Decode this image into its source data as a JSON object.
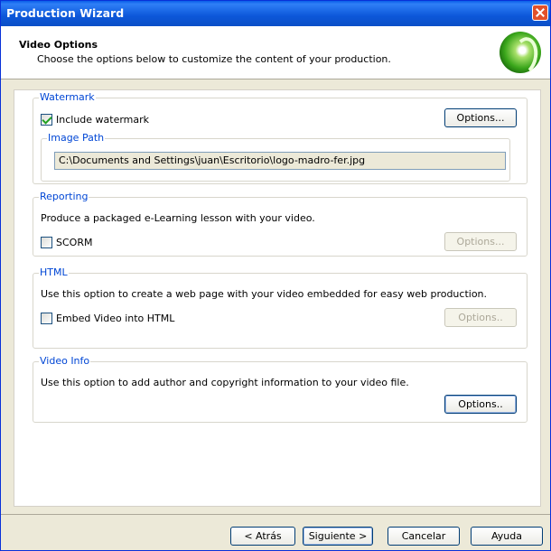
{
  "window": {
    "title": "Production Wizard"
  },
  "header": {
    "title": "Video Options",
    "subtitle": "Choose the options below to customize the content of your production."
  },
  "watermark": {
    "title": "Watermark",
    "checkbox_label": "Include watermark",
    "checked": true,
    "options_label": "Options...",
    "image_path_title": "Image Path",
    "image_path_value": "C:\\Documents and Settings\\juan\\Escritorio\\logo-madro-fer.jpg"
  },
  "reporting": {
    "title": "Reporting",
    "description": "Produce a packaged  e-Learning lesson with your video.",
    "checkbox_label": "SCORM",
    "checked": false,
    "options_label": "Options..."
  },
  "html": {
    "title": "HTML",
    "description": "Use this option to create a web page with your video embedded for easy web production.",
    "checkbox_label": "Embed Video into HTML",
    "checked": false,
    "options_label": "Options.."
  },
  "video_info": {
    "title": "Video Info",
    "description": "Use this option to add author and copyright information to your video file.",
    "options_label": "Options.."
  },
  "footer": {
    "back_label": "< Atrás",
    "next_label": "Siguiente >",
    "cancel_label": "Cancelar",
    "help_label": "Ayuda"
  }
}
